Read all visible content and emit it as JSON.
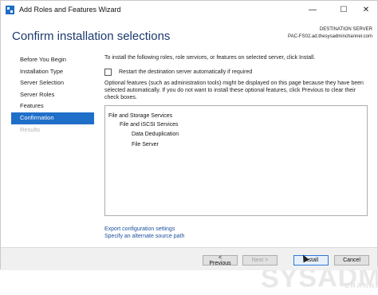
{
  "window": {
    "title": "Add Roles and Features Wizard",
    "controls": {
      "minimize": "—",
      "maximize": "☐",
      "close": "✕"
    }
  },
  "header": {
    "title": "Confirm installation selections",
    "destination_label": "DESTINATION SERVER",
    "destination_value": "PAC-FS02.ad.thesysadminchannel.com"
  },
  "nav": {
    "items": [
      {
        "label": "Before You Begin",
        "state": "normal"
      },
      {
        "label": "Installation Type",
        "state": "normal"
      },
      {
        "label": "Server Selection",
        "state": "normal"
      },
      {
        "label": "Server Roles",
        "state": "normal"
      },
      {
        "label": "Features",
        "state": "normal"
      },
      {
        "label": "Confirmation",
        "state": "active"
      },
      {
        "label": "Results",
        "state": "disabled"
      }
    ]
  },
  "content": {
    "intro": "To install the following roles, role services, or features on selected server, click Install.",
    "restart_label": "Restart the destination server automatically if required",
    "restart_checked": false,
    "optional_note": "Optional features (such as administration tools) might be displayed on this page because they have been selected automatically. If you do not want to install these optional features, click Previous to clear their check boxes.",
    "selections": [
      "File and Storage Services",
      "File and iSCSI Services",
      "Data Deduplication",
      "File Server"
    ],
    "links": {
      "export": "Export configuration settings",
      "alternate_source": "Specify an alternate source path"
    }
  },
  "watermark": {
    "main": "SYSADMIN",
    "sub": "CHANNEL"
  },
  "footer": {
    "previous": "< Previous",
    "next": "Next >",
    "install": "Install",
    "cancel": "Cancel"
  },
  "colors": {
    "accent": "#1f6fc9",
    "title": "#1c3a6e",
    "link": "#1a4f9c"
  }
}
